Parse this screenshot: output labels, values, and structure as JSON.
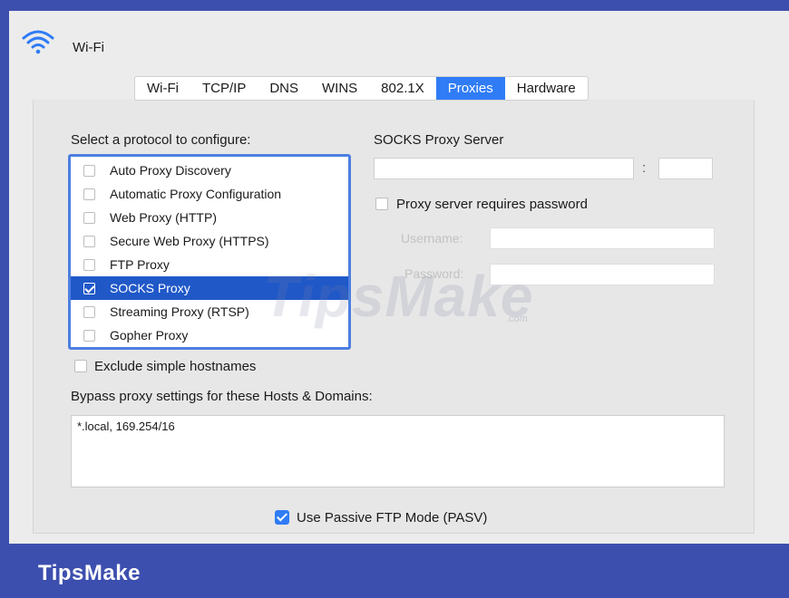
{
  "window": {
    "title": "Wi-Fi",
    "icon": "wifi-icon"
  },
  "tabs": [
    {
      "label": "Wi-Fi",
      "active": false
    },
    {
      "label": "TCP/IP",
      "active": false
    },
    {
      "label": "DNS",
      "active": false
    },
    {
      "label": "WINS",
      "active": false
    },
    {
      "label": "802.1X",
      "active": false
    },
    {
      "label": "Proxies",
      "active": true
    },
    {
      "label": "Hardware",
      "active": false
    }
  ],
  "protocols": {
    "heading": "Select a protocol to configure:",
    "items": [
      {
        "label": "Auto Proxy Discovery",
        "checked": false
      },
      {
        "label": "Automatic Proxy Configuration",
        "checked": false
      },
      {
        "label": "Web Proxy (HTTP)",
        "checked": false
      },
      {
        "label": "Secure Web Proxy (HTTPS)",
        "checked": false
      },
      {
        "label": "FTP Proxy",
        "checked": false
      },
      {
        "label": "SOCKS Proxy",
        "checked": true
      },
      {
        "label": "Streaming Proxy (RTSP)",
        "checked": false
      },
      {
        "label": "Gopher Proxy",
        "checked": false
      }
    ],
    "selected": "SOCKS Proxy"
  },
  "server": {
    "heading": "SOCKS Proxy Server",
    "host_value": "",
    "separator": ":",
    "port_value": "",
    "requires_password_label": "Proxy server requires password",
    "requires_password": false,
    "username_label": "Username:",
    "username_value": "",
    "password_label": "Password:",
    "password_value": ""
  },
  "exclude_simple_hostnames": {
    "label": "Exclude simple hostnames",
    "checked": false
  },
  "bypass": {
    "label": "Bypass proxy settings for these Hosts & Domains:",
    "value": "*.local, 169.254/16"
  },
  "passive_ftp": {
    "label": "Use Passive FTP Mode (PASV)",
    "checked": true
  },
  "watermark": {
    "text": "TipsMake",
    "suffix": ".com"
  },
  "footer": {
    "brand": "TipsMake"
  },
  "colors": {
    "accent": "#2f7cf6",
    "selection": "#2058c8",
    "frame": "#3d4fae"
  }
}
